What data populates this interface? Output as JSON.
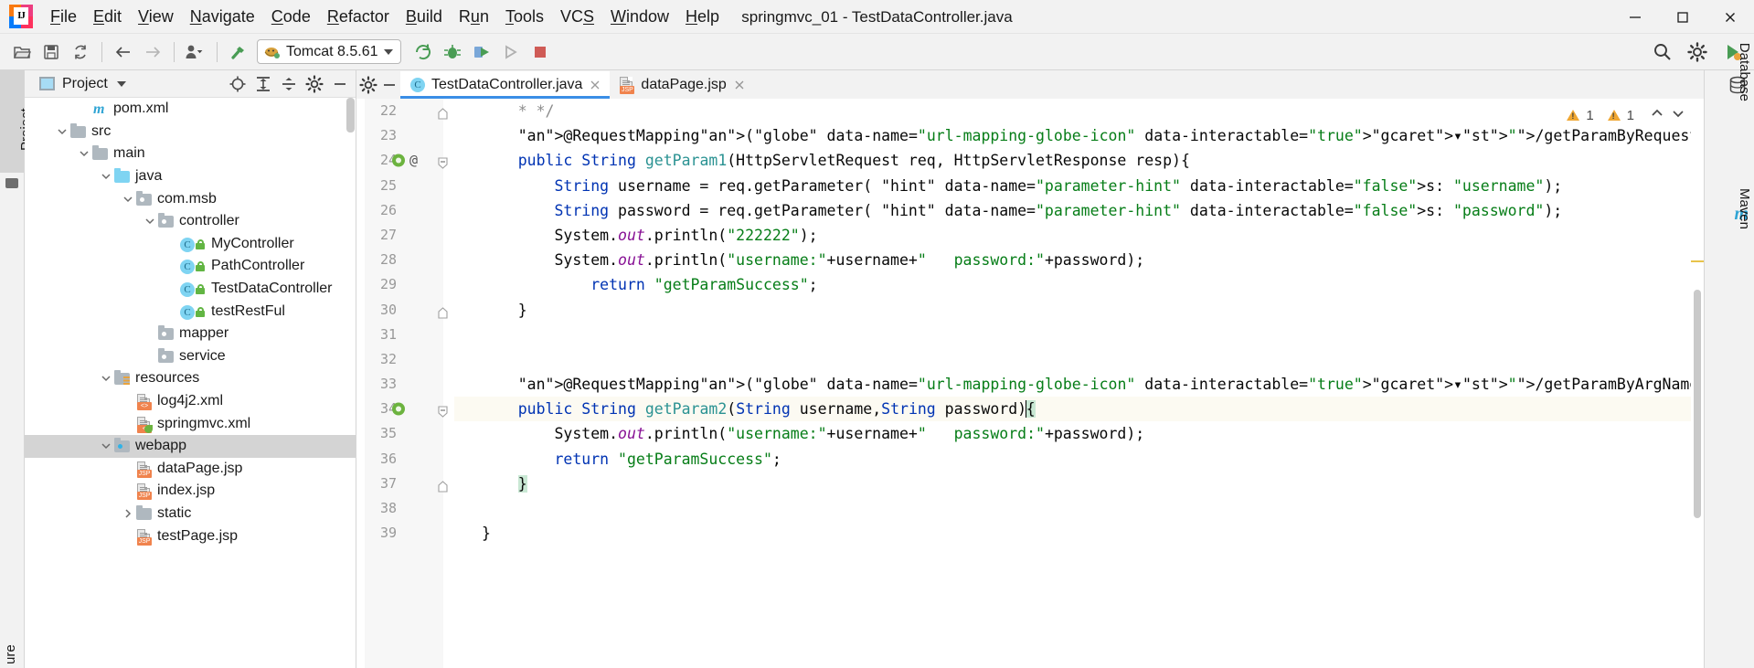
{
  "window": {
    "title": "springmvc_01 - TestDataController.java",
    "minimize_label": "Minimize",
    "maximize_label": "Maximize",
    "close_label": "Close"
  },
  "menubar": {
    "items": [
      {
        "label": "File",
        "mnemonic": "F"
      },
      {
        "label": "Edit",
        "mnemonic": "E"
      },
      {
        "label": "View",
        "mnemonic": "V"
      },
      {
        "label": "Navigate",
        "mnemonic": "N"
      },
      {
        "label": "Code",
        "mnemonic": "C"
      },
      {
        "label": "Refactor",
        "mnemonic": "R"
      },
      {
        "label": "Build",
        "mnemonic": "B"
      },
      {
        "label": "Run",
        "mnemonic": "u"
      },
      {
        "label": "Tools",
        "mnemonic": "T"
      },
      {
        "label": "VCS",
        "mnemonic": "S"
      },
      {
        "label": "Window",
        "mnemonic": "W"
      },
      {
        "label": "Help",
        "mnemonic": "H"
      }
    ]
  },
  "toolbar": {
    "open_label": "Open",
    "save_label": "Save All",
    "sync_label": "Synchronize",
    "back_label": "Back",
    "forward_label": "Forward",
    "profile_label": "Manage Profiles",
    "build_label": "Build Project",
    "run_config": {
      "name": "Tomcat 8.5.61",
      "icon": "tomcat-icon"
    },
    "rerun_label": "Rerun",
    "debug_label": "Debug",
    "coverage_label": "Run with Coverage",
    "profiler_label": "Profiler",
    "stop_label": "Stop",
    "search_label": "Search Everywhere",
    "settings_label": "Settings",
    "updates_label": "Updates"
  },
  "left_stripe": {
    "project_label": "Project",
    "structure_label": "ure"
  },
  "project_panel": {
    "title": "Project",
    "locate_label": "Select Opened File",
    "expand_label": "Expand All",
    "collapse_label": "Collapse All",
    "settings_label": "Show Options Menu",
    "hide_label": "Hide",
    "tree": [
      {
        "label": "pom.xml",
        "depth": 2,
        "icon": "maven-file-icon",
        "twisty": "none",
        "selected": false
      },
      {
        "label": "src",
        "depth": 1,
        "icon": "folder-grey",
        "twisty": "expanded",
        "selected": false
      },
      {
        "label": "main",
        "depth": 2,
        "icon": "folder-grey",
        "twisty": "expanded",
        "selected": false
      },
      {
        "label": "java",
        "depth": 3,
        "icon": "folder-blue",
        "twisty": "expanded",
        "selected": false
      },
      {
        "label": "com.msb",
        "depth": 4,
        "icon": "package-icon",
        "twisty": "expanded",
        "selected": false
      },
      {
        "label": "controller",
        "depth": 5,
        "icon": "package-icon",
        "twisty": "expanded",
        "selected": false
      },
      {
        "label": "MyController",
        "depth": 6,
        "icon": "java-class-icon",
        "twisty": "none",
        "selected": false
      },
      {
        "label": "PathController",
        "depth": 6,
        "icon": "java-class-icon",
        "twisty": "none",
        "selected": false
      },
      {
        "label": "TestDataController",
        "depth": 6,
        "icon": "java-class-icon",
        "twisty": "none",
        "selected": false
      },
      {
        "label": "testRestFul",
        "depth": 6,
        "icon": "java-class-icon",
        "twisty": "none",
        "selected": false
      },
      {
        "label": "mapper",
        "depth": 5,
        "icon": "package-icon",
        "twisty": "none",
        "selected": false
      },
      {
        "label": "service",
        "depth": 5,
        "icon": "package-icon",
        "twisty": "none",
        "selected": false
      },
      {
        "label": "resources",
        "depth": 3,
        "icon": "resources-folder-icon",
        "twisty": "expanded",
        "selected": false
      },
      {
        "label": "log4j2.xml",
        "depth": 4,
        "icon": "xml-file-icon",
        "twisty": "none",
        "selected": false
      },
      {
        "label": "springmvc.xml",
        "depth": 4,
        "icon": "spring-xml-file-icon",
        "twisty": "none",
        "selected": false
      },
      {
        "label": "webapp",
        "depth": 3,
        "icon": "webapp-folder-icon",
        "twisty": "expanded",
        "selected": true
      },
      {
        "label": "dataPage.jsp",
        "depth": 4,
        "icon": "jsp-file-icon",
        "twisty": "none",
        "selected": false
      },
      {
        "label": "index.jsp",
        "depth": 4,
        "icon": "jsp-file-icon",
        "twisty": "none",
        "selected": false
      },
      {
        "label": "static",
        "depth": 4,
        "icon": "folder-grey",
        "twisty": "collapsed",
        "selected": false
      },
      {
        "label": "testPage.jsp",
        "depth": 4,
        "icon": "jsp-file-icon",
        "twisty": "none",
        "selected": false
      }
    ]
  },
  "editor": {
    "tabs": [
      {
        "label": "TestDataController.java",
        "icon": "java-class-icon",
        "active": true,
        "closable": true
      },
      {
        "label": "dataPage.jsp",
        "icon": "jsp-file-icon",
        "active": false,
        "closable": true
      }
    ],
    "inspections": {
      "warnings_primary": "1",
      "warnings_secondary": "1",
      "prev_label": "Previous Highlighted Error",
      "next_label": "Next Highlighted Error"
    },
    "current_line": 34,
    "first_line_number": 22,
    "lines": [
      {
        "n": 22,
        "gutter_icon": "",
        "at": false,
        "fold": "end",
        "text": "    * */"
      },
      {
        "n": 23,
        "gutter_icon": "",
        "at": false,
        "fold": "",
        "text": "    @RequestMapping(\"/getParamByRequest.do\")"
      },
      {
        "n": 24,
        "gutter_icon": "spring-bean-icon",
        "at": true,
        "fold": "start",
        "text": "    public String getParam1(HttpServletRequest req, HttpServletResponse resp){"
      },
      {
        "n": 25,
        "gutter_icon": "",
        "at": false,
        "fold": "",
        "text": "        String username = req.getParameter( s: \"username\");"
      },
      {
        "n": 26,
        "gutter_icon": "",
        "at": false,
        "fold": "",
        "text": "        String password = req.getParameter( s: \"password\");"
      },
      {
        "n": 27,
        "gutter_icon": "",
        "at": false,
        "fold": "",
        "text": "        System.out.println(\"222222\");"
      },
      {
        "n": 28,
        "gutter_icon": "",
        "at": false,
        "fold": "",
        "text": "        System.out.println(\"username:\"+username+\"   password:\"+password);"
      },
      {
        "n": 29,
        "gutter_icon": "",
        "at": false,
        "fold": "",
        "text": "            return \"getParamSuccess\";"
      },
      {
        "n": 30,
        "gutter_icon": "",
        "at": false,
        "fold": "end",
        "text": "    }"
      },
      {
        "n": 31,
        "gutter_icon": "",
        "at": false,
        "fold": "",
        "text": ""
      },
      {
        "n": 32,
        "gutter_icon": "",
        "at": false,
        "fold": "",
        "text": ""
      },
      {
        "n": 33,
        "gutter_icon": "",
        "at": false,
        "fold": "",
        "text": "    @RequestMapping(\"/getParamByArgName.do\")"
      },
      {
        "n": 34,
        "gutter_icon": "spring-bean-icon",
        "at": false,
        "fold": "start",
        "text": "    public String getParam2(String username,String password){"
      },
      {
        "n": 35,
        "gutter_icon": "",
        "at": false,
        "fold": "",
        "text": "        System.out.println(\"username:\"+username+\"   password:\"+password);"
      },
      {
        "n": 36,
        "gutter_icon": "",
        "at": false,
        "fold": "",
        "text": "        return \"getParamSuccess\";"
      },
      {
        "n": 37,
        "gutter_icon": "",
        "at": false,
        "fold": "end",
        "text": "    }"
      },
      {
        "n": 38,
        "gutter_icon": "",
        "at": false,
        "fold": "",
        "text": ""
      },
      {
        "n": 39,
        "gutter_icon": "",
        "at": false,
        "fold": "",
        "text": "}"
      }
    ],
    "url_mappings": [
      "/getParamByRequest.do",
      "/getParamByArgName.do"
    ],
    "parameter_hints": [
      "s:"
    ]
  },
  "right_stripe": {
    "items": [
      {
        "label": "Database",
        "icon": "database-icon"
      },
      {
        "label": "Maven",
        "icon": "maven-icon"
      }
    ]
  },
  "colors": {
    "accent_blue": "#3a8ee6",
    "keyword": "#0033b3",
    "string": "#067d17",
    "annotation": "#9e880d",
    "method": "#2a9292",
    "static_field": "#871094",
    "selection_grey": "#d4d4d4",
    "current_line": "#fcfaf2",
    "warning": "#f0a732",
    "panel_bg": "#f2f2f2"
  }
}
